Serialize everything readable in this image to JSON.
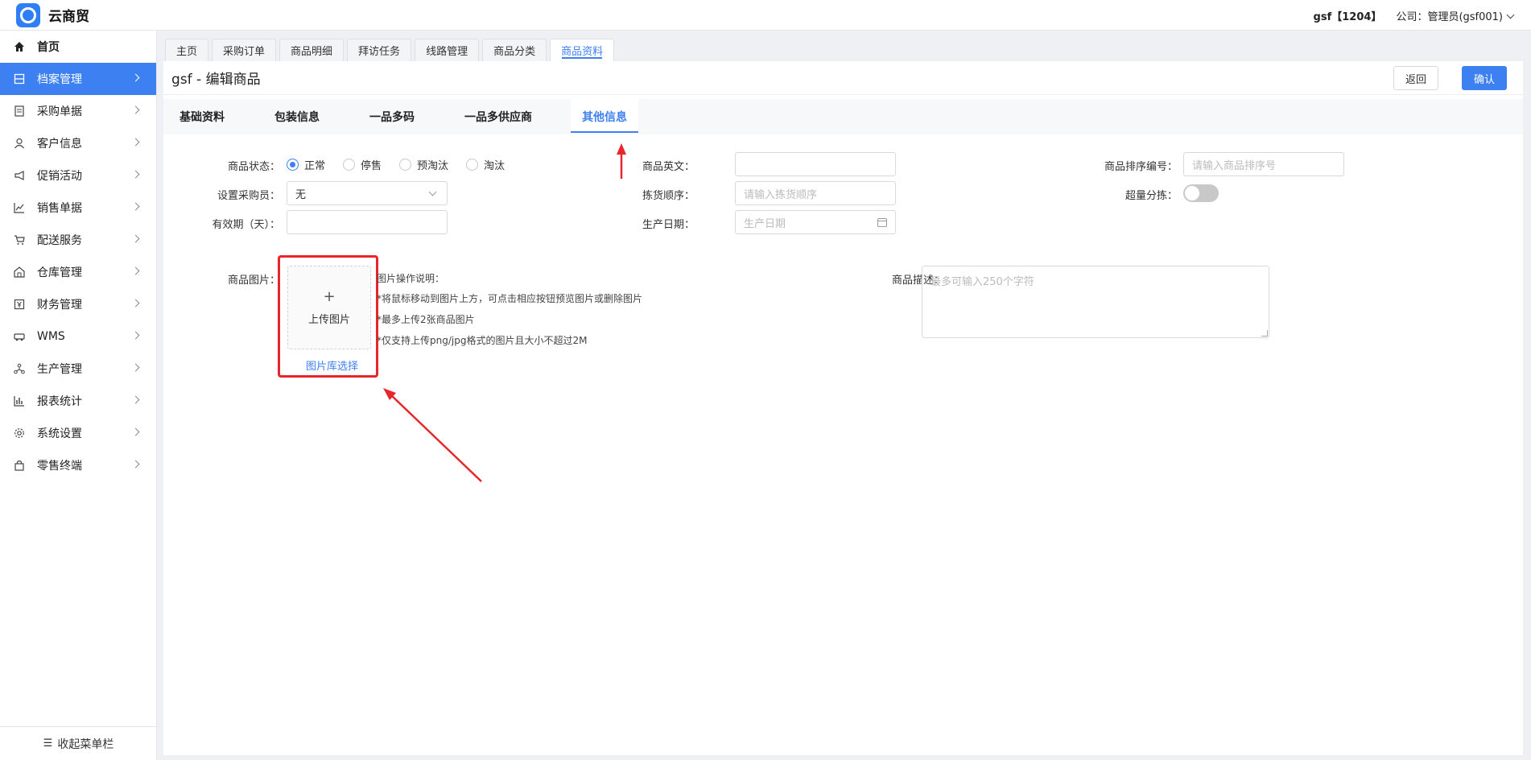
{
  "app": {
    "title": "云商贸"
  },
  "topbar": {
    "user": "gsf【1204】",
    "company": "公司：管理员(gsf001)"
  },
  "sidebar": {
    "items": [
      {
        "label": "首页",
        "icon": "home-icon"
      },
      {
        "label": "档案管理",
        "icon": "archive-icon"
      },
      {
        "label": "采购单据",
        "icon": "purchase-doc-icon"
      },
      {
        "label": "客户信息",
        "icon": "user-icon"
      },
      {
        "label": "促销活动",
        "icon": "megaphone-icon"
      },
      {
        "label": "销售单据",
        "icon": "trend-icon"
      },
      {
        "label": "配送服务",
        "icon": "cart-icon"
      },
      {
        "label": "仓库管理",
        "icon": "warehouse-icon"
      },
      {
        "label": "财务管理",
        "icon": "finance-icon"
      },
      {
        "label": "WMS",
        "icon": "truck-icon"
      },
      {
        "label": "生产管理",
        "icon": "network-icon"
      },
      {
        "label": "报表统计",
        "icon": "bar-chart-icon"
      },
      {
        "label": "系统设置",
        "icon": "gear-icon"
      },
      {
        "label": "零售终端",
        "icon": "bag-icon"
      }
    ],
    "active_index": 1,
    "collapse_label": "收起菜单栏"
  },
  "tabs": [
    "主页",
    "采购订单",
    "商品明细",
    "拜访任务",
    "线路管理",
    "商品分类",
    "商品资料"
  ],
  "page": {
    "title": "gsf - 编辑商品",
    "back_label": "返回",
    "confirm_label": "确认"
  },
  "subtabs": [
    "基础资料",
    "包装信息",
    "一品多码",
    "一品多供应商",
    "其他信息"
  ],
  "form": {
    "status_label": "商品状态：",
    "status_options": [
      "正常",
      "停售",
      "预淘汰",
      "淘汰"
    ],
    "status_selected": "正常",
    "buyer_label": "设置采购员：",
    "buyer_value": "无",
    "validity_label": "有效期（天）：",
    "validity_value": "",
    "english_label": "商品英文：",
    "english_value": "",
    "pick_order_label": "拣货顺序：",
    "pick_order_placeholder": "请输入拣货顺序",
    "prod_date_label": "生产日期：",
    "prod_date_placeholder": "生产日期",
    "sort_no_label": "商品排序编号：",
    "sort_no_placeholder": "请输入商品排序号",
    "over_pick_label": "超量分拣：",
    "over_pick_on": false,
    "image_label": "商品图片：",
    "upload_label": "上传图片",
    "library_link": "图片库选择",
    "notes": [
      "图片操作说明：",
      "*将鼠标移动到图片上方，可点击相应按钮预览图片或删除图片",
      "*最多上传2张商品图片",
      "*仅支持上传png/jpg格式的图片且大小不超过2M"
    ],
    "desc_label": "商品描述：",
    "desc_placeholder": "最多可输入250个字符"
  },
  "colors": {
    "accent": "#3d80f2",
    "annotation": "#e8252b"
  }
}
